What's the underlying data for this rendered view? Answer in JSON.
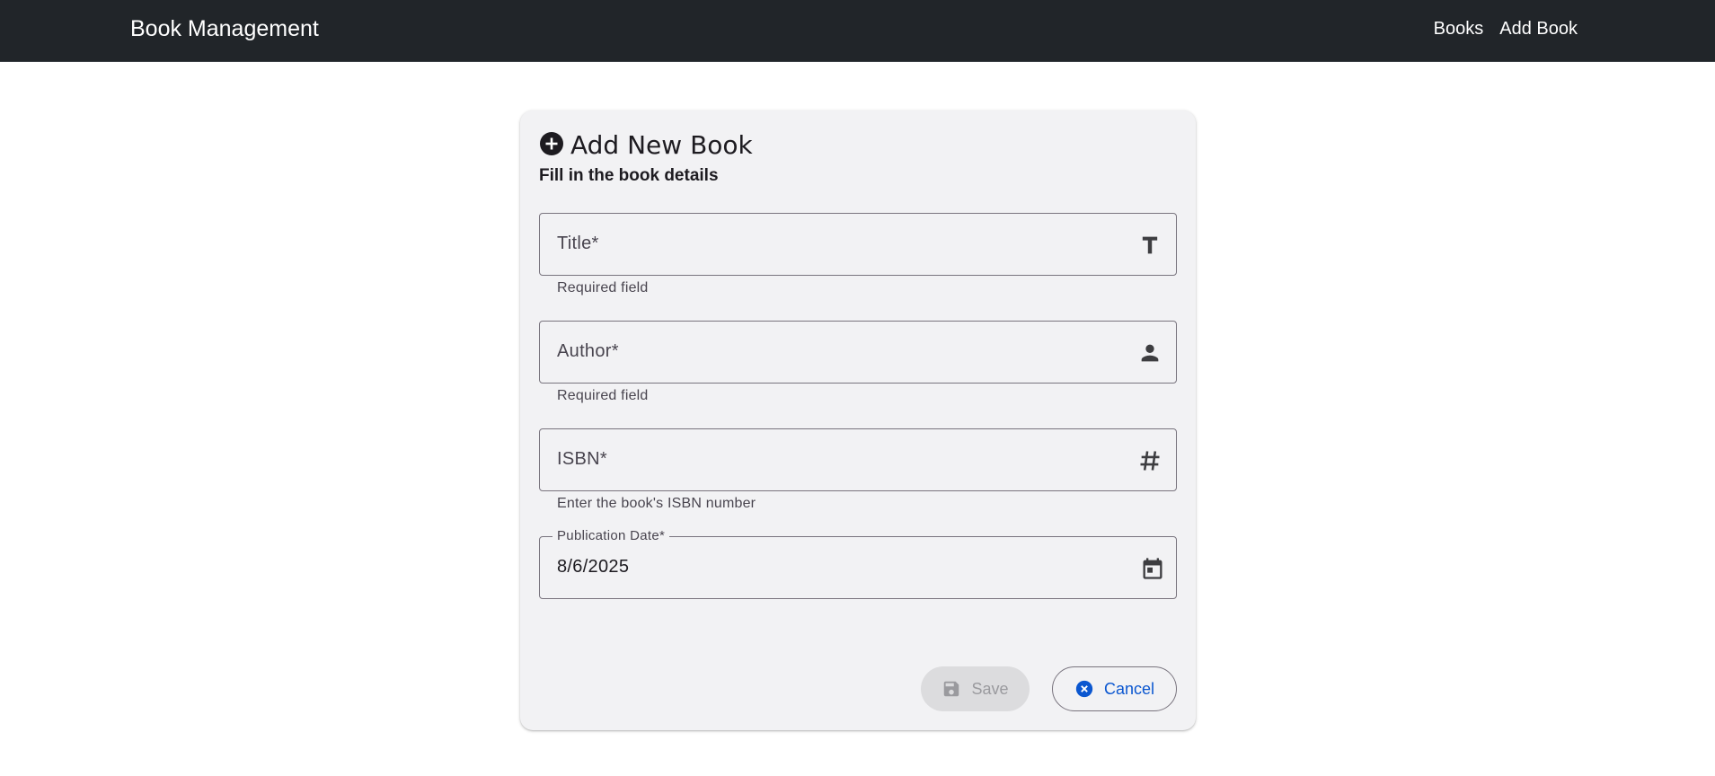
{
  "navbar": {
    "brand": "Book Management",
    "links": [
      "Books",
      "Add Book"
    ],
    "background": "#212529"
  },
  "card": {
    "title": "Add New Book",
    "subtitle": "Fill in the book details",
    "title_icon": "add-circle-icon"
  },
  "fields": {
    "title": {
      "label": "Title*",
      "helper": "Required field",
      "icon": "text-format-icon"
    },
    "author": {
      "label": "Author*",
      "helper": "Required field",
      "icon": "person-icon"
    },
    "isbn": {
      "label": "ISBN*",
      "helper": "Enter the book's ISBN number",
      "icon": "hashtag-icon"
    },
    "publication_date": {
      "label": "Publication Date*",
      "value": "8/6/2025",
      "icon": "calendar-icon"
    }
  },
  "buttons": {
    "save": {
      "label": "Save",
      "icon": "save-icon",
      "disabled": true
    },
    "cancel": {
      "label": "Cancel",
      "icon": "cancel-icon"
    }
  },
  "colors": {
    "accent": "#0b57d0",
    "card_background": "#f2f2f4"
  }
}
